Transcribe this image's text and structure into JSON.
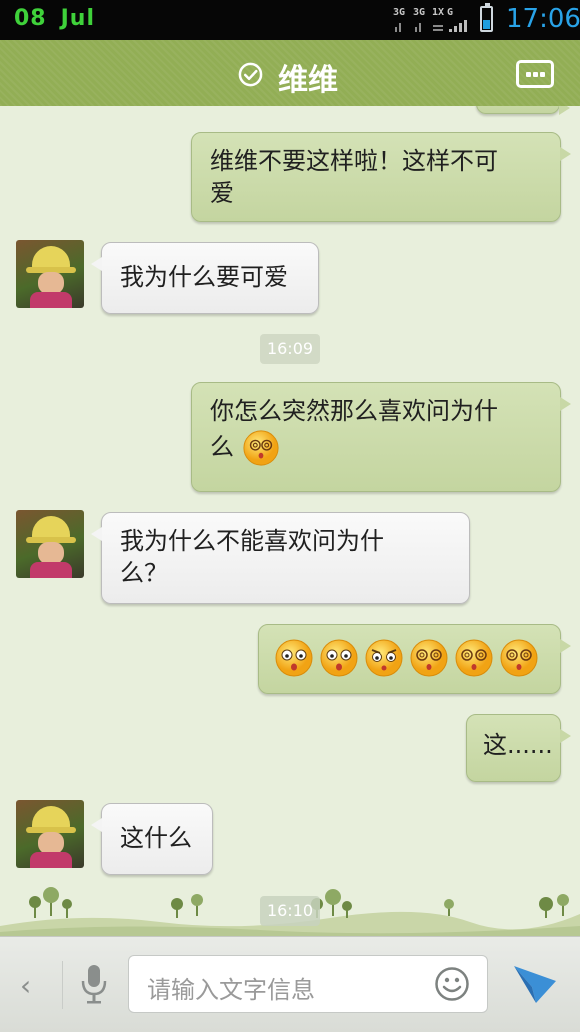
{
  "status_bar": {
    "day": "08",
    "month": "Jul",
    "net_labels": [
      "3G",
      "3G",
      "1X",
      "G"
    ],
    "time": "17:06",
    "battery_level": 0.35
  },
  "header": {
    "title": "维维",
    "verified_icon": "check-circle-icon",
    "more_icon": "more-dots-icon"
  },
  "messages": [
    {
      "side": "out",
      "text_line1": "维维不要这样啦！这样不可",
      "text_line2": "爱"
    },
    {
      "side": "in",
      "text": "我为什么要可爱"
    },
    {
      "timestamp": "16:09"
    },
    {
      "side": "out",
      "text_line1": "你怎么突然那么喜欢问为什",
      "text_line2": "么",
      "emoji": "dizzy-emoji-icon"
    },
    {
      "side": "in",
      "text_line1": "我为什么不能喜欢问为什",
      "text_line2": "么？"
    },
    {
      "side": "out",
      "emojis": [
        "shocked-emoji-icon",
        "shocked-emoji-icon",
        "angry-emoji-icon",
        "dizzy-emoji-icon",
        "dizzy-emoji-icon",
        "dizzy-emoji-icon"
      ]
    },
    {
      "side": "out",
      "text": "这......"
    },
    {
      "side": "in",
      "text": "这什么"
    },
    {
      "timestamp": "16:10"
    }
  ],
  "input_bar": {
    "placeholder": "请输入文字信息",
    "icons": [
      "back-chevron-icon",
      "microphone-icon",
      "smiley-icon",
      "send-arrow-icon"
    ]
  },
  "colors": {
    "header": "#92ae55",
    "chat_bg": "#e8efdc",
    "out_bubble": "#cbdba8",
    "in_bubble": "#f3f3f3",
    "time_accent": "#29a3e8"
  }
}
